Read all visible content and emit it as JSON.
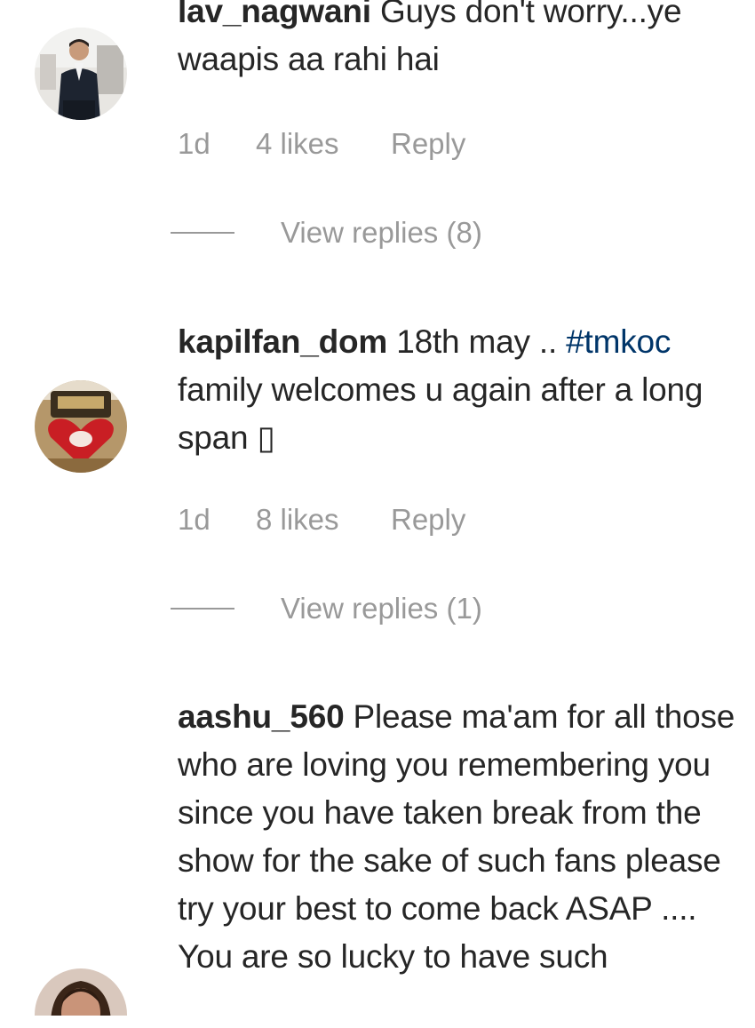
{
  "comments": [
    {
      "username": "lav_nagwani",
      "text": "Guys don't worry...ye waapis aa rahi hai",
      "time": "1d",
      "likes": "4 likes",
      "reply_label": "Reply",
      "view_replies": "View replies (8)"
    },
    {
      "username": "kapilfan_dom",
      "text_before": "18th may ..",
      "hashtag": "#tmkoc",
      "text_after": "family welcomes u again after a long span ▯",
      "time": "1d",
      "likes": "8 likes",
      "reply_label": "Reply",
      "view_replies": "View replies (1)"
    },
    {
      "username": "aashu_560",
      "text": "Please ma'am for all those who are loving you remembering you since you have taken break from the show for the sake of such fans please try your best to come back ASAP .... You are so lucky to have such"
    }
  ],
  "colors": {
    "text": "#262626",
    "muted": "#999999",
    "hashtag": "#003569",
    "background": "#ffffff"
  },
  "icons": {
    "avatar_1": "avatar-man-in-suit",
    "avatar_2": "avatar-heart-cake",
    "avatar_3": "avatar-woman"
  }
}
